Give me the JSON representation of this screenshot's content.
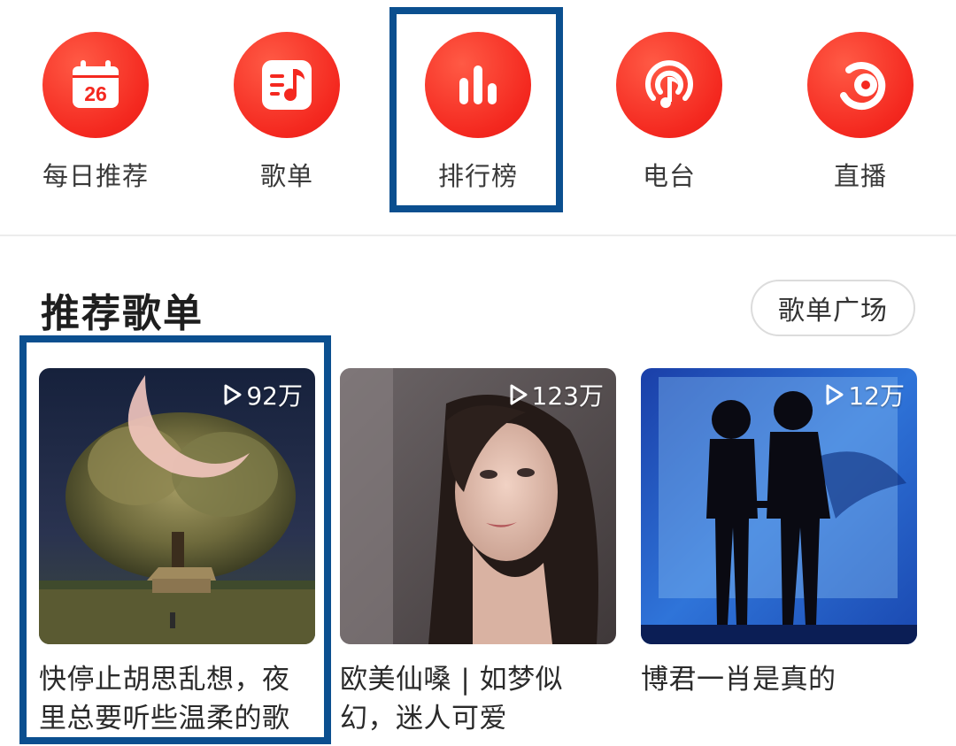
{
  "quick_nav": [
    {
      "label": "每日推荐",
      "icon": "calendar-icon",
      "badge": "26"
    },
    {
      "label": "歌单",
      "icon": "playlist-icon"
    },
    {
      "label": "排行榜",
      "icon": "chart-bars-icon"
    },
    {
      "label": "电台",
      "icon": "radio-icon"
    },
    {
      "label": "直播",
      "icon": "live-icon"
    }
  ],
  "section": {
    "title": "推荐歌单",
    "square_button": "歌单广场"
  },
  "playlists": [
    {
      "play_count": "92万",
      "title": "快停止胡思乱想，夜里总要听些温柔的歌"
    },
    {
      "play_count": "123万",
      "title": "欧美仙嗓 | 如梦似幻，迷人可爱"
    },
    {
      "play_count": "12万",
      "title": "博君一肖是真的"
    }
  ],
  "colors": {
    "accent_red": "#f4281f",
    "highlight_blue": "#0b4f8f"
  }
}
